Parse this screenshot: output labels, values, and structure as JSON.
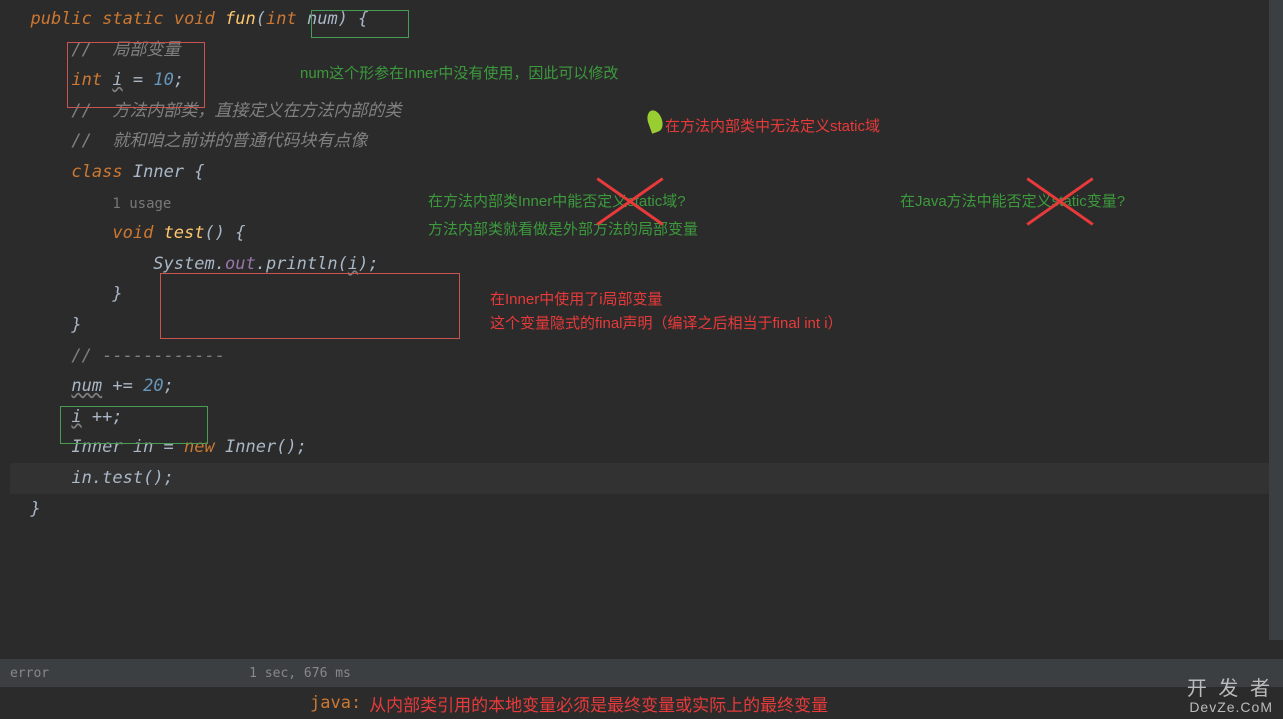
{
  "code": {
    "l1_public": "public",
    "l1_static": "static",
    "l1_void": "void",
    "l1_fun": "fun",
    "l1_int": "int",
    "l1_num": "num",
    "l1_brace": " {",
    "l2_comment": "//  局部变量",
    "l3_int": "int",
    "l3_i": "i",
    "l3_eq": " = ",
    "l3_val": "10",
    "l3_semi": ";",
    "l4_comment": "//  方法内部类，直接定义在方法内部的类",
    "l5_comment": "//  就和咱之前讲的普通代码块有点像",
    "l6_class": "class",
    "l6_inner": "Inner",
    "l6_brace": " {",
    "l7_usage": "1 usage",
    "l8_void": "void",
    "l8_test": "test",
    "l8_rest": "() {",
    "l9_system": "System",
    "l9_out": "out",
    "l9_println": "println",
    "l9_i": "i",
    "l10_brace": "}",
    "l11_brace": "}",
    "l12_comment": "// ------------",
    "l13_num": "num",
    "l13_rest": " += ",
    "l13_val": "20",
    "l13_semi": ";",
    "l14_i": "i",
    "l14_rest": " ++;",
    "l15_inner": "Inner",
    "l15_in": " in = ",
    "l15_new": "new",
    "l15_inner2": "Inner",
    "l15_rest": "();",
    "l16_in": "in",
    "l16_test": "test",
    "l16_rest": "();",
    "l17_brace": "}"
  },
  "annotations": {
    "a1": "num这个形参在Inner中没有使用，因此可以修改",
    "a2": "在方法内部类中无法定义static域",
    "a3": "在方法内部类Inner中能否定义static域?",
    "a4": "方法内部类就看做是外部方法的局部变量",
    "a5": "在Java方法中能否定义static变量?",
    "a6": "在Inner中使用了i局部变量",
    "a7": "这个变量隐式的final声明（编译之后相当于final int i）"
  },
  "status": {
    "error_label": "error",
    "timing": "1 sec, 676 ms"
  },
  "error": {
    "java": "java:",
    "msg": "从内部类引用的本地变量必须是最终变量或实际上的最终变量"
  },
  "watermark": {
    "line1": "开 发 者",
    "line2": "DevZe.CoM"
  }
}
